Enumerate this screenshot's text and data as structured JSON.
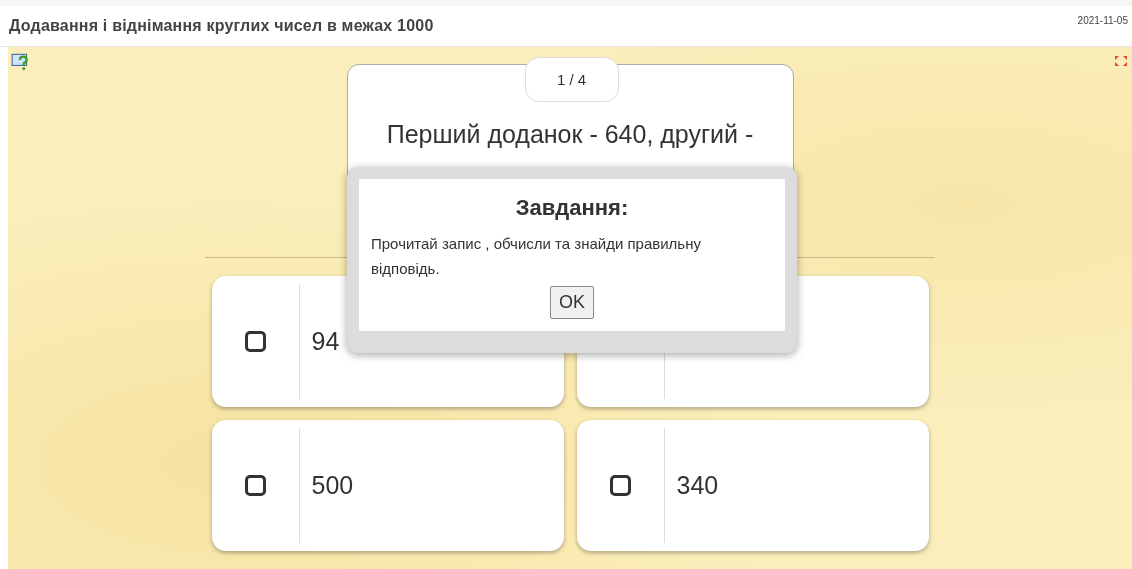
{
  "header": {
    "title": "Додавання і віднімання круглих чисел в межах 1000",
    "date": "2021-11-05"
  },
  "question": {
    "counter": "1 / 4",
    "text": "Перший доданок - 640, другий -"
  },
  "options": [
    {
      "kind": "answer",
      "text": "94",
      "checked": false
    },
    {
      "kind": "covered"
    },
    {
      "kind": "answer",
      "text": "500",
      "checked": false
    },
    {
      "kind": "answer",
      "text": "340",
      "checked": false
    }
  ],
  "dialog": {
    "title": "Завдання:",
    "message": "Прочитай запис , обчисли та знайди правильну відповідь.",
    "button": "OK"
  }
}
